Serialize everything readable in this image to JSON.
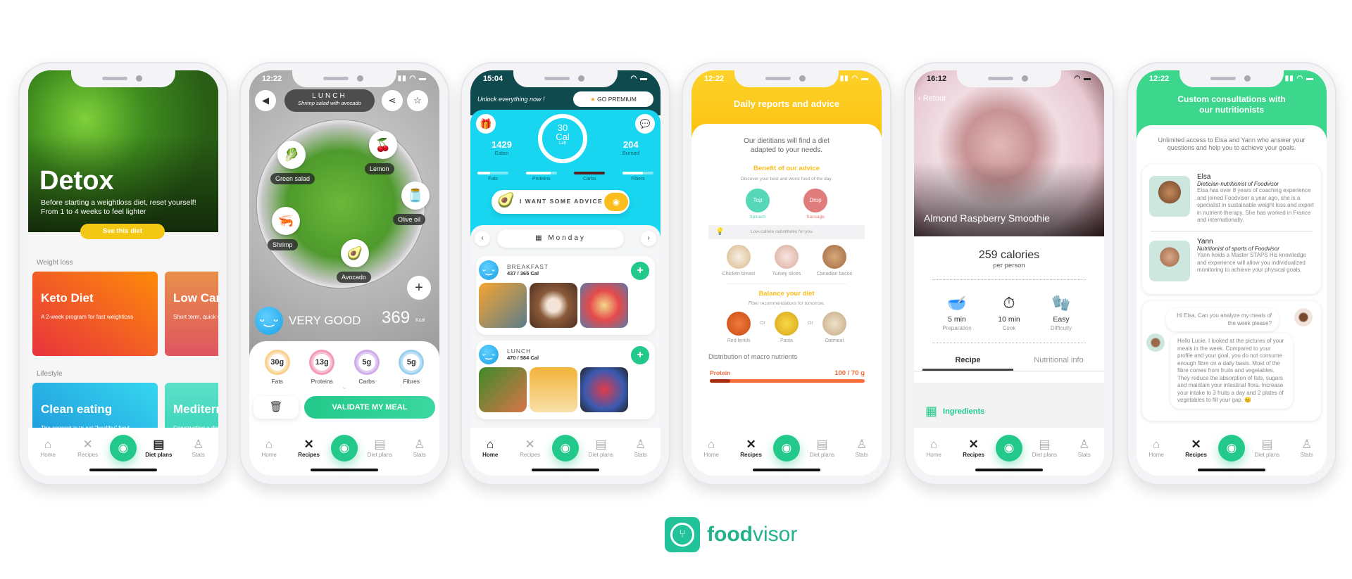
{
  "tabbar": {
    "home": "Home",
    "recipes": "Recipes",
    "diet_plans": "Diet plans",
    "stats": "Stats"
  },
  "phone1": {
    "hero_title": "Detox",
    "hero_subtitle": "Before starting a weightloss diet, reset yourself! From 1 to 4 weeks to  feel lighter",
    "hero_button": "See this diet",
    "section_weight_loss": "Weight loss",
    "section_lifestyle": "Lifestyle",
    "cards_weight_loss": [
      {
        "title": "Keto Diet",
        "subtitle": "A 2-week program for fast weightloss"
      },
      {
        "title": "Low Carb",
        "subtitle": "Short term, quick weight loss."
      }
    ],
    "cards_lifestyle": [
      {
        "title": "Clean eating",
        "subtitle": "The concept is to eat \"healthy\" food"
      },
      {
        "title": "Mediterranean",
        "subtitle": "Constructing a diet"
      }
    ],
    "active_tab": "Diet plans"
  },
  "phone2": {
    "time": "12:22",
    "meal_label": "LUNCH",
    "meal_name": "Shrimp salad with avocado",
    "ingredients": [
      "Green salad",
      "Lemon",
      "Olive oil",
      "Shrimp",
      "Avocado"
    ],
    "rating": "VERY GOOD",
    "kcal_value": "369",
    "kcal_unit": "Kcal",
    "macros": [
      {
        "value": "30g",
        "label": "Fats",
        "color": "#f5a623"
      },
      {
        "value": "13g",
        "label": "Proteins",
        "color": "#e8417a"
      },
      {
        "value": "5g",
        "label": "Carbs",
        "color": "#a65fd6"
      },
      {
        "value": "5g",
        "label": "Fibres",
        "color": "#3aa6e0"
      }
    ],
    "validate_button": "VALIDATE MY MEAL",
    "active_tab": "Recipes"
  },
  "phone3": {
    "time": "15:04",
    "unlock_text": "Unlock everything now !",
    "premium_button": "GO PREMIUM",
    "eaten_value": "1429",
    "eaten_label": "Eaten",
    "cal_left_value": "30",
    "cal_left_unit": "Cal",
    "cal_left_label": "Left",
    "burned_value": "204",
    "burned_label": "Burned",
    "macro_bars": [
      {
        "label": "Fats",
        "fill": 0.4
      },
      {
        "label": "Proteins",
        "fill": 0.8
      },
      {
        "label": "Carbs",
        "fill": 1.0
      },
      {
        "label": "Fibers",
        "fill": 0.65
      }
    ],
    "advice_button": "I WANT SOME ADVICE",
    "day": "Monday",
    "meals": [
      {
        "name": "BREAKFAST",
        "calories": "437 / 365 Cal"
      },
      {
        "name": "LUNCH",
        "calories": "470 / 584 Cal"
      }
    ],
    "active_tab": "Home"
  },
  "phone4": {
    "time": "12:22",
    "header_title": "Daily reports and advice",
    "intro": "Our dietitians will find a diet adapted to your needs.",
    "benefit_title": "Benefit of our advice",
    "benefit_sub": "Discover your best and  worst food of the day.",
    "top_label": "Top",
    "top_food": "Spinach",
    "drop_label": "Drop",
    "drop_food": "Sausage",
    "substitutes_banner": "Low-calorie substitutes for you",
    "substitutes": [
      "Chicken breast",
      "Turkey slices",
      "Canadian bacon"
    ],
    "balance_title": "Balance your diet",
    "balance_sub": "Fiber recommendations for tomorrow.",
    "fiber_foods": [
      "Red lentils",
      "Pasta",
      "Oatmeal"
    ],
    "or_label": "Or",
    "distribution_title": "Distribution of macro nutrients",
    "protein_label": "Protein",
    "protein_value": "100  /  70 g",
    "protein_fill": 0.13,
    "active_tab": "Recipes"
  },
  "phone5": {
    "time": "16:12",
    "back_label": "Retour",
    "recipe_title": "Almond Raspberry Smoothie",
    "calories": "259 calories",
    "per_person": "per person",
    "stats": [
      {
        "value": "5 min",
        "label": "Preparation"
      },
      {
        "value": "10 min",
        "label": "Cook"
      },
      {
        "value": "Easy",
        "label": "Difficulty"
      }
    ],
    "tab_recipe": "Recipe",
    "tab_nutrition": "Nutritional info",
    "ingredients_title": "Ingredients",
    "active_tab": "Recipes"
  },
  "phone6": {
    "time": "12:22",
    "header_title": "Custom consultations with our nutritionists",
    "intro": "Unlimited access to Elsa and Yann who answer your questions and help you to achieve your goals.",
    "nutritionists": [
      {
        "name": "Elsa",
        "role": "Dietician-nutritionist of Foodvisor",
        "bio": "Elsa has over 8 years of coaching experience and joined Foodvisor a year ago, she is a specialist in sustainable weight loss and expert in nutrient-therapy. She has worked in France and internationally."
      },
      {
        "name": "Yann",
        "role": "Nutritionist of sports of Foodvisor",
        "bio": "Yann holds a Master STAPS His knowledge and experience will allow you individualized monitoring to achieve your physical goals."
      }
    ],
    "chat_user": "Hi Elsa, Can you analyze my meals of the week please?",
    "chat_reply": "Hello Lucie, I looked at the pictures of your meals in the week. Compared to your profile and your goal, you do not consume enough fibre on a daily basis. Most of the fibre comes from fruits and vegetables. They reduce the absorption of fats, sugars and maintain your intestinal flora. Increase your intake to 3 fruits a day and 2 plates of vegetables to fill your gap. 😊",
    "active_tab": "Recipes"
  },
  "brand": {
    "name_bold": "food",
    "name_light": "visor",
    "color": "#22b28c"
  }
}
